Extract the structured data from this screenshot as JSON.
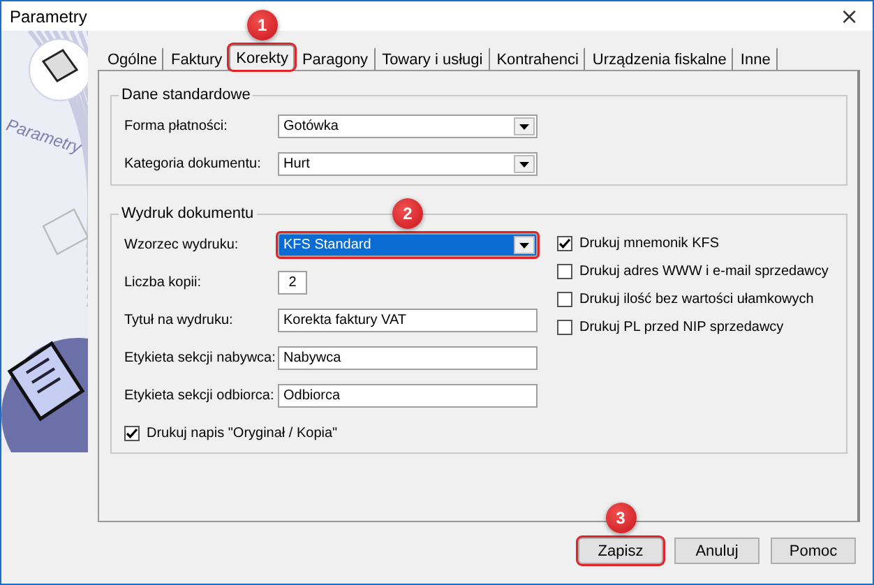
{
  "window": {
    "title": "Parametry",
    "close": "×"
  },
  "sidebar": {
    "caption": "Parametry"
  },
  "tabs": [
    {
      "label": "Ogólne",
      "selected": false
    },
    {
      "label": "Faktury",
      "selected": false
    },
    {
      "label": "Korekty",
      "selected": true,
      "highlighted": true,
      "callout": "1"
    },
    {
      "label": "Paragony",
      "selected": false
    },
    {
      "label": "Towary i usługi",
      "selected": false
    },
    {
      "label": "Kontrahenci",
      "selected": false
    },
    {
      "label": "Urządzenia fiskalne",
      "selected": false
    },
    {
      "label": "Inne",
      "selected": false
    }
  ],
  "groups": [
    {
      "title": "Dane standardowe",
      "fields": [
        {
          "kind": "combo",
          "label": "Forma płatności:",
          "value": "Gotówka"
        },
        {
          "kind": "combo",
          "label": "Kategoria dokumentu:",
          "value": "Hurt"
        }
      ]
    },
    {
      "title": "Wydruk dokumentu",
      "fields": [
        {
          "kind": "combo",
          "label": "Wzorzec wydruku:",
          "value": "KFS Standard",
          "focused": true,
          "highlighted": true,
          "callout": "2"
        },
        {
          "kind": "number",
          "label": "Liczba kopii:",
          "value": "2"
        },
        {
          "kind": "text",
          "label": "Tytuł na wydruku:",
          "value": "Korekta faktury VAT"
        },
        {
          "kind": "text",
          "label": "Etykieta sekcji nabywca:",
          "value": "Nabywca"
        },
        {
          "kind": "text",
          "label": "Etykieta sekcji odbiorca:",
          "value": "Odbiorca"
        }
      ],
      "bottom_checkbox": {
        "label": "Drukuj napis \"Oryginał / Kopia\"",
        "checked": true
      },
      "checkboxes": [
        {
          "label": "Drukuj mnemonik KFS",
          "checked": true
        },
        {
          "label": "Drukuj adres WWW i e-mail sprzedawcy",
          "checked": false
        },
        {
          "label": "Drukuj ilość bez wartości ułamkowych",
          "checked": false
        },
        {
          "label": "Drukuj PL przed NIP sprzedawcy",
          "checked": false
        }
      ]
    }
  ],
  "buttons": [
    {
      "label": "Zapisz",
      "highlighted": true,
      "callout": "3"
    },
    {
      "label": "Anuluj",
      "highlighted": false
    },
    {
      "label": "Pomoc",
      "highlighted": false
    }
  ]
}
